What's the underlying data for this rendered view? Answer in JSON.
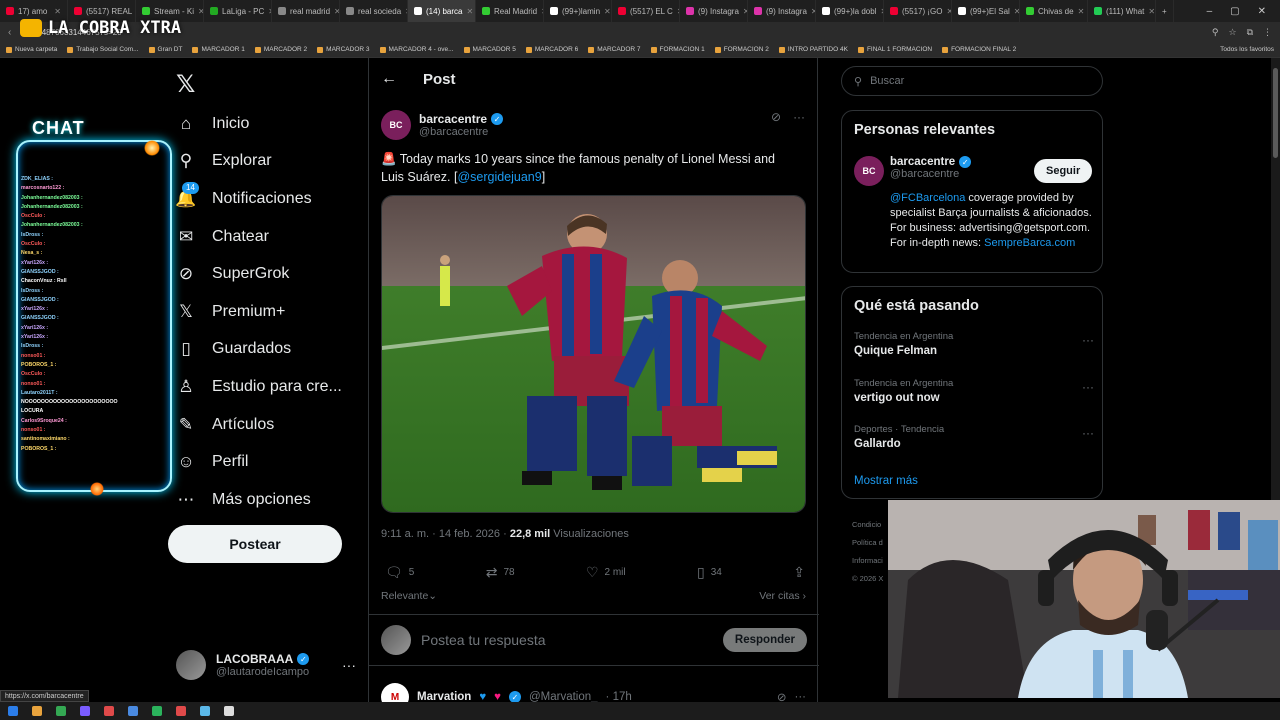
{
  "browser": {
    "tabs": [
      {
        "label": "17) amo",
        "color": "#e03",
        "active": false
      },
      {
        "label": "(5517) REAL",
        "color": "#e03",
        "active": false
      },
      {
        "label": "Stream - Ki",
        "color": "#3c3",
        "active": false
      },
      {
        "label": "LaLiga - PC",
        "color": "#2a2",
        "active": false
      },
      {
        "label": "real madrid",
        "color": "#888",
        "active": false
      },
      {
        "label": "real socieda",
        "color": "#888",
        "active": false
      },
      {
        "label": "(14) barca",
        "color": "#fff",
        "active": true
      },
      {
        "label": "Real Madrid",
        "color": "#3c3",
        "active": false
      },
      {
        "label": "(99+)lamin",
        "color": "#fff",
        "active": false
      },
      {
        "label": "(5517) EL C",
        "color": "#e03",
        "active": false
      },
      {
        "label": "(9) Instagra",
        "color": "#d3a",
        "active": false
      },
      {
        "label": "(9) Instagra",
        "color": "#d3a",
        "active": false
      },
      {
        "label": "(99+)la dobl",
        "color": "#fff",
        "active": false
      },
      {
        "label": "(5517) ¡GO",
        "color": "#e03",
        "active": false
      },
      {
        "label": "(99+)El Sal",
        "color": "#fff",
        "active": false
      },
      {
        "label": "Chivas de ",
        "color": "#3c3",
        "active": false
      },
      {
        "label": "(111) What",
        "color": "#2c5",
        "active": false
      }
    ],
    "url": "48706331446757s=20",
    "bookmarks": [
      "Nueva carpeta",
      "Trabajo Social Com...",
      "Gran DT",
      "MARCADOR 1",
      "MARCADOR 2",
      "MARCADOR 3",
      "MARCADOR 4 - ove...",
      "MARCADOR 5",
      "MARCADOR 6",
      "MARCADOR 7",
      "FORMACION 1",
      "FORMACION 2",
      "INTRO PARTIDO 4K",
      "FINAL 1 FORMACION",
      "FORMACION FINAL 2"
    ],
    "bookmarks_right": "Todos los favoritos",
    "status_url": "https://x.com/barcacentre"
  },
  "overlay": {
    "logo_text": "LA COBRA XTRA",
    "chat_title": "CHAT",
    "chat_lines": [
      {
        "text": "ZDK_ELIAS :",
        "color": "#8fd4ff"
      },
      {
        "text": "marcosnarto122 :",
        "color": "#ff9ad5"
      },
      {
        "text": "Johanhernandez082003 :",
        "color": "#7dff9a"
      },
      {
        "text": "Johanhernandez082003 :",
        "color": "#7dff9a"
      },
      {
        "text": "OscCulo :",
        "color": "#ff5a5a"
      },
      {
        "text": "Johanhernandez082003 :",
        "color": "#7dff9a"
      },
      {
        "text": "IsDross :",
        "color": "#8fd4ff"
      },
      {
        "text": "OscCulo :",
        "color": "#ff5a5a"
      },
      {
        "text": "Nesa_s :",
        "color": "#ffd96a"
      },
      {
        "text": "xYari126x :",
        "color": "#c9a7ff"
      },
      {
        "text": "GIANSSJGOD :",
        "color": "#8fd4ff"
      },
      {
        "text": "ChaconVnuz : Rsll",
        "color": "#ffffff"
      },
      {
        "text": "IsDross :",
        "color": "#8fd4ff"
      },
      {
        "text": "GIANSSJGOD :",
        "color": "#8fd4ff"
      },
      {
        "text": "xYari126x :",
        "color": "#c9a7ff"
      },
      {
        "text": "GIANSSJGOD :",
        "color": "#8fd4ff"
      },
      {
        "text": "xYari126x :",
        "color": "#c9a7ff"
      },
      {
        "text": "xYari126x :",
        "color": "#c9a7ff"
      },
      {
        "text": "IsDross :",
        "color": "#8fd4ff"
      },
      {
        "text": "nonso01 :",
        "color": "#ff5a5a"
      },
      {
        "text": "POBOROS_1 :",
        "color": "#ffd96a"
      },
      {
        "text": "OscCulo :",
        "color": "#ff5a5a"
      },
      {
        "text": "nonso01 :",
        "color": "#ff5a5a"
      },
      {
        "text": "Lautaro2011T :",
        "color": "#8fd4ff"
      },
      {
        "text": "NOOOOOOOOOOOOOOOOOOOOOOO",
        "color": "#ffffff"
      },
      {
        "text": "LOCURA",
        "color": "#ffffff"
      },
      {
        "text": "Carlos9Sroque24 :",
        "color": "#ff9ad5"
      },
      {
        "text": "nonso01 :",
        "color": "#ff5a5a"
      },
      {
        "text": "santinomaximiano :",
        "color": "#ffd96a"
      },
      {
        "text": "POBOROS_1 :",
        "color": "#ffd96a"
      }
    ]
  },
  "nav": {
    "items": [
      {
        "name": "home",
        "label": "Inicio",
        "icon": "⌂"
      },
      {
        "name": "explore",
        "label": "Explorar",
        "icon": "⚲"
      },
      {
        "name": "notifications",
        "label": "Notificaciones",
        "icon": "🔔"
      },
      {
        "name": "chat",
        "label": "Chatear",
        "icon": "✉"
      },
      {
        "name": "supergrok",
        "label": "SuperGrok",
        "icon": "⊘"
      },
      {
        "name": "premium",
        "label": "Premium+",
        "icon": "𝕏"
      },
      {
        "name": "bookmarks",
        "label": "Guardados",
        "icon": "▯"
      },
      {
        "name": "creator-studio",
        "label": "Estudio para cre...",
        "icon": "♙"
      },
      {
        "name": "articles",
        "label": "Artículos",
        "icon": "✎"
      },
      {
        "name": "profile",
        "label": "Perfil",
        "icon": "☺"
      },
      {
        "name": "more-options",
        "label": "Más opciones",
        "icon": "⋯"
      }
    ],
    "notifications_badge": "14",
    "post_button": "Postear",
    "user": {
      "name": "LACOBRAAA",
      "handle": "@lautarodeIcampo"
    }
  },
  "main": {
    "header": "Post",
    "tweet": {
      "author_name": "barcacentre",
      "author_handle": "@barcacentre",
      "avatar_text": "BC",
      "text": "🚨 Today marks 10 years since the famous penalty of Lionel Messi and Luis Suárez. [",
      "mention": "@sergidejuan9",
      "text_end": "]",
      "time": "9:11 a. m. · 14 feb. 2026 · ",
      "views_count": "22,8 mil",
      "views_label": "Visualizaciones",
      "replies": "5",
      "retweets": "78",
      "likes": "2 mil",
      "bookmarks": "34"
    },
    "sort_label": "Relevante",
    "quotes_label": "Ver citas",
    "reply_placeholder": "Postea tu respuesta",
    "reply_button": "Responder",
    "next_tweet": {
      "name": "Marvation",
      "handle": "@Marvation_",
      "time": "· 17h"
    }
  },
  "sidebar": {
    "search_placeholder": "Buscar",
    "relevant": {
      "title": "Personas relevantes",
      "name": "barcacentre",
      "handle": "@barcacentre",
      "follow": "Seguir",
      "bio_link": "@FCBarcelona",
      "bio_text": " coverage provided by specialist Barça journalists & aficionados. For business: advertising@getsport.com. For in-depth news: ",
      "bio_link2": "SempreBarca.com"
    },
    "trends": {
      "title": "Qué está pasando",
      "items": [
        {
          "context": "Tendencia en Argentina",
          "title": "Quique Felman"
        },
        {
          "context": "Tendencia en Argentina",
          "title": "vertigo out now"
        },
        {
          "context": "Deportes · Tendencia",
          "title": "Gallardo"
        }
      ],
      "show_more": "Mostrar más"
    },
    "footer": [
      "Condicio",
      "Política d",
      "Informaci",
      "© 2026 X"
    ]
  }
}
